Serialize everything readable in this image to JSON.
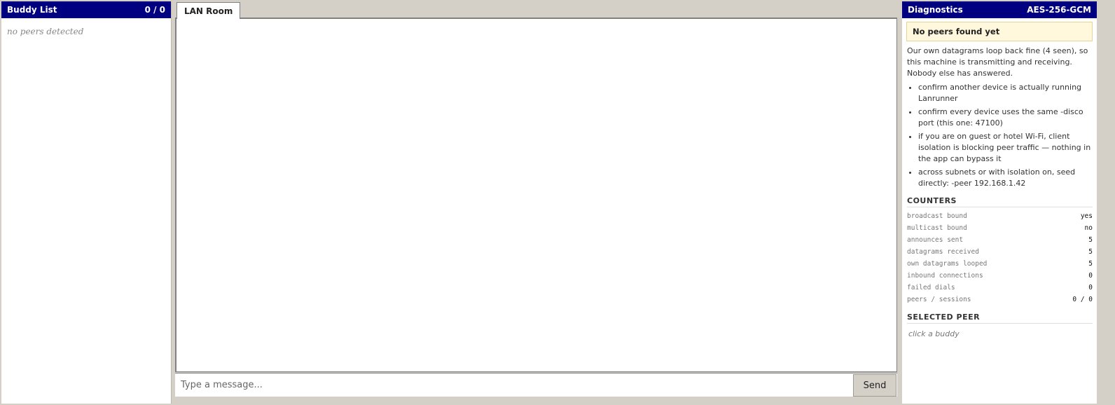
{
  "buddy": {
    "title": "Buddy List",
    "count": "0 / 0",
    "empty_text": "no peers detected"
  },
  "chat": {
    "tabs": [
      {
        "label": "LAN Room",
        "active": true
      }
    ],
    "input_placeholder": "Type a message...",
    "send_label": "Send"
  },
  "diagnostics": {
    "title": "Diagnostics",
    "cipher": "AES-256-GCM",
    "warning": "No peers found yet",
    "paragraph": "Our own datagrams loop back fine (4 seen), so this machine is transmitting and receiving. Nobody else has answered.",
    "tips": [
      "confirm another device is actually running Lanrunner",
      "confirm every device uses the same -disco port (this one: 47100)",
      "if you are on guest or hotel Wi-Fi, client isolation is blocking peer traffic — nothing in the app can bypass it",
      "across subnets or with isolation on, seed directly: -peer 192.168.1.42"
    ],
    "counters_title": "COUNTERS",
    "counters": [
      {
        "label": "broadcast bound",
        "value": "yes"
      },
      {
        "label": "multicast bound",
        "value": "no"
      },
      {
        "label": "announces sent",
        "value": "5"
      },
      {
        "label": "datagrams received",
        "value": "5"
      },
      {
        "label": "own datagrams looped",
        "value": "5"
      },
      {
        "label": "inbound connections",
        "value": "0"
      },
      {
        "label": "failed dials",
        "value": "0"
      },
      {
        "label": "peers / sessions",
        "value": "0 / 0"
      }
    ],
    "selected_title": "SELECTED PEER",
    "selected_hint": "click a buddy"
  }
}
